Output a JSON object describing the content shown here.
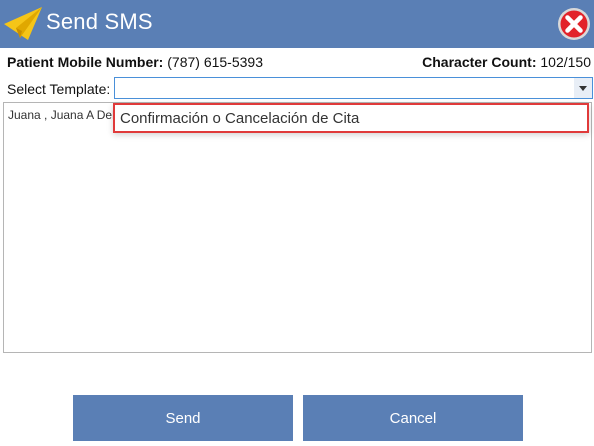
{
  "window": {
    "title": "Send SMS",
    "accent_color": "#5a7fb5",
    "close_icon": "close-x-icon"
  },
  "patient": {
    "mobile_label": "Patient Mobile Number:",
    "mobile_value": "(787) 615-5393"
  },
  "character_count": {
    "label": "Character Count:",
    "value": "102/150"
  },
  "template": {
    "label": "Select Template:",
    "selected_value": "",
    "options": [
      "Confirmación o Cancelación de Cita"
    ],
    "highlight_color": "#e03a3a"
  },
  "message": {
    "text": "Juana , Juana A Del"
  },
  "buttons": {
    "send_label": "Send",
    "cancel_label": "Cancel"
  }
}
